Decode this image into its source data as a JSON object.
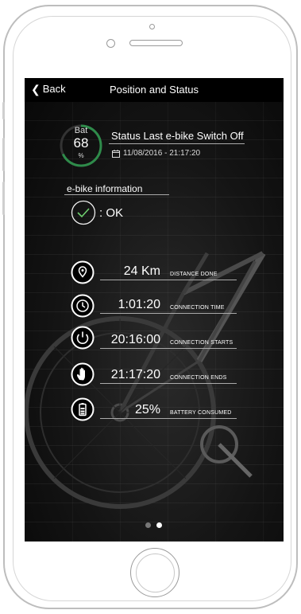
{
  "navbar": {
    "back_label": "Back",
    "title": "Position and Status"
  },
  "battery": {
    "label": "Bat",
    "value": "68",
    "unit": "%",
    "ring_color": "#2e8b4a",
    "level_fraction": 0.68
  },
  "status": {
    "title": "Status Last e-bike Switch Off",
    "date": "11/08/2016 - 21:17:20"
  },
  "info": {
    "title": "e-bike information",
    "ok_text": ": OK"
  },
  "stats": [
    {
      "icon": "map-pin-icon",
      "value": "24 Km",
      "label": "DISTANCE DONE"
    },
    {
      "icon": "clock-icon",
      "value": "1:01:20",
      "label": "CONNECTION TIME"
    },
    {
      "icon": "power-icon",
      "value": "20:16:00",
      "label": "CONNECTION STARTS"
    },
    {
      "icon": "hand-icon",
      "value": "21:17:20",
      "label": "CONNECTION ENDS"
    },
    {
      "icon": "battery-icon",
      "value": "25%",
      "label": "BATTERY CONSUMED"
    }
  ],
  "pager": {
    "count": 2,
    "active_index": 1
  }
}
